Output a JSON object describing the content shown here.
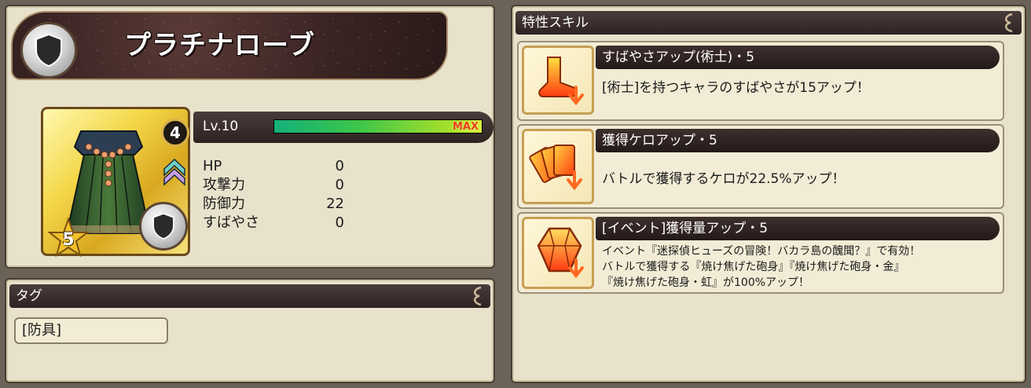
{
  "item": {
    "name": "プラチナローブ",
    "level_limit_break": "4",
    "rarity": "5",
    "level_label": "Lv.10",
    "level_progress": 1.0,
    "level_max_label": "MAX"
  },
  "stats": [
    {
      "label": "HP",
      "value": "0"
    },
    {
      "label": "攻撃力",
      "value": "0"
    },
    {
      "label": "防御力",
      "value": "22"
    },
    {
      "label": "すばやさ",
      "value": "0"
    }
  ],
  "tags": {
    "header": "タグ",
    "items": [
      "[防具]"
    ]
  },
  "skills": {
    "header": "特性スキル",
    "list": [
      {
        "name": "すばやさアップ(術士)・5",
        "icon": "boot-icon",
        "lines": [
          "[術士]を持つキャラのすばやさが15アップ！"
        ]
      },
      {
        "name": "獲得ケロアップ・5",
        "icon": "cards-icon",
        "lines": [
          "バトルで獲得するケロが22.5%アップ！"
        ]
      },
      {
        "name": "[イベント]獲得量アップ・5",
        "icon": "gem-icon",
        "lines": [
          "イベント『迷探偵ヒューズの冒険！バカラ島の醜聞？』で有効！",
          "バトルで獲得する『焼け焦げた砲身』『焼け焦げた砲身・金』",
          "『焼け焦げた砲身・虹』が100%アップ！"
        ]
      }
    ]
  },
  "colors": {
    "panel_bg": "#e8e2cc",
    "header_bg": "#2e2322",
    "level_bar_start": "#14b07a",
    "level_bar_end": "#d8f040",
    "max_text": "#e8401a"
  }
}
